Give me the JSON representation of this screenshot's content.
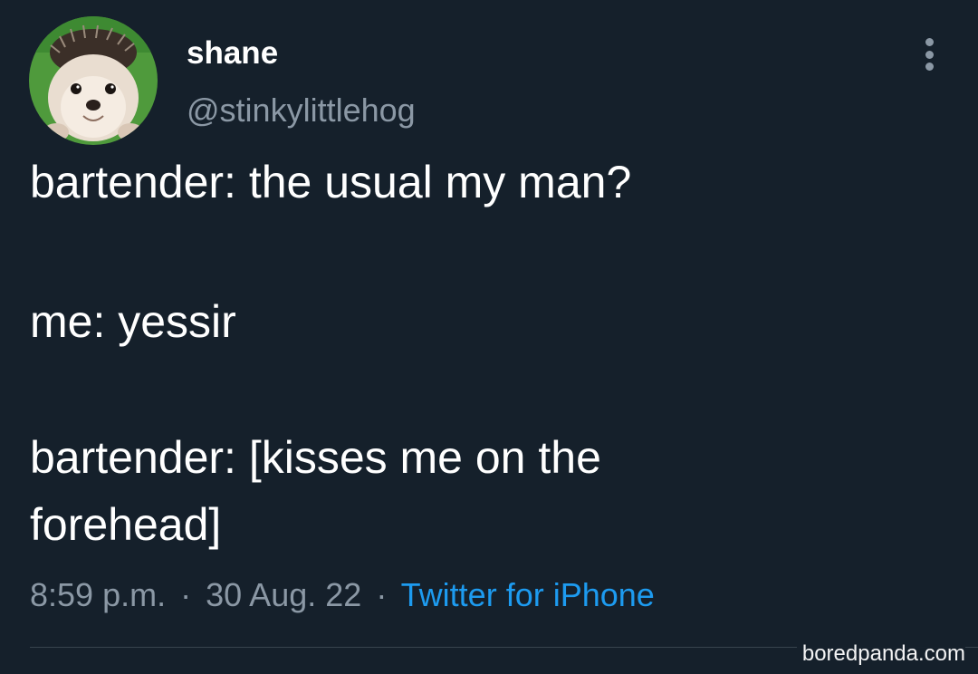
{
  "tweet": {
    "display_name": "shane",
    "handle": "@stinkylittlehog",
    "lines": [
      "bartender: the usual my man?",
      "me: yessir",
      "bartender: [kisses me on the",
      "forehead]"
    ],
    "time": "8:59 p.m.",
    "date": "30 Aug. 22",
    "separator": "·",
    "source": "Twitter for iPhone"
  },
  "watermark": "boredpanda.com",
  "icons": {
    "avatar": "hedgehog-avatar",
    "more": "more-options-icon"
  },
  "colors": {
    "background": "#15202b",
    "text": "#ffffff",
    "secondary": "#8b98a5",
    "link": "#1d9bf0"
  }
}
